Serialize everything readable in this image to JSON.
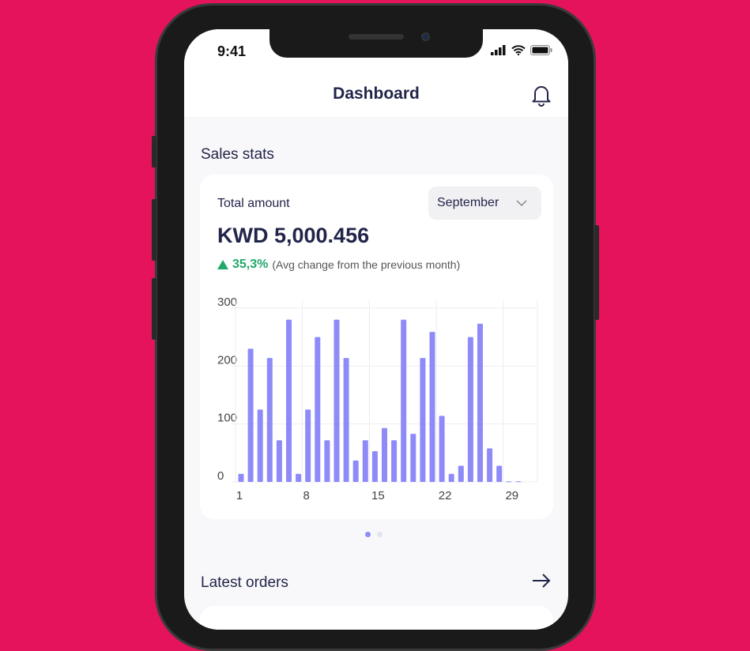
{
  "status_bar": {
    "time": "9:41"
  },
  "header": {
    "title": "Dashboard"
  },
  "sales": {
    "section_title": "Sales stats",
    "total_label": "Total amount",
    "month": "September",
    "amount": "KWD 5,000.456",
    "change_pct": "35,3%",
    "change_note": "(Avg change from the previous month)"
  },
  "latest": {
    "section_title": "Latest orders"
  },
  "colors": {
    "background": "#E4135B",
    "bar": "#8E8BF8",
    "positive": "#22A86B",
    "text": "#22254A"
  },
  "chart_data": {
    "type": "bar",
    "x": [
      1,
      2,
      3,
      4,
      5,
      6,
      7,
      8,
      9,
      10,
      11,
      12,
      13,
      14,
      15,
      16,
      17,
      18,
      19,
      20,
      21,
      22,
      23,
      24,
      25,
      26,
      27,
      28,
      29,
      30
    ],
    "values": [
      14,
      230,
      125,
      214,
      72,
      280,
      14,
      125,
      250,
      72,
      280,
      214,
      37,
      72,
      53,
      93,
      72,
      280,
      83,
      214,
      259,
      114,
      14,
      28,
      250,
      273,
      58,
      28,
      1,
      1
    ],
    "xticks": [
      "1",
      "8",
      "15",
      "22",
      "29"
    ],
    "yticks": [
      "0",
      "100",
      "200",
      "300"
    ],
    "ylim": [
      0,
      300
    ],
    "grid": true,
    "title": "",
    "xlabel": "",
    "ylabel": ""
  }
}
